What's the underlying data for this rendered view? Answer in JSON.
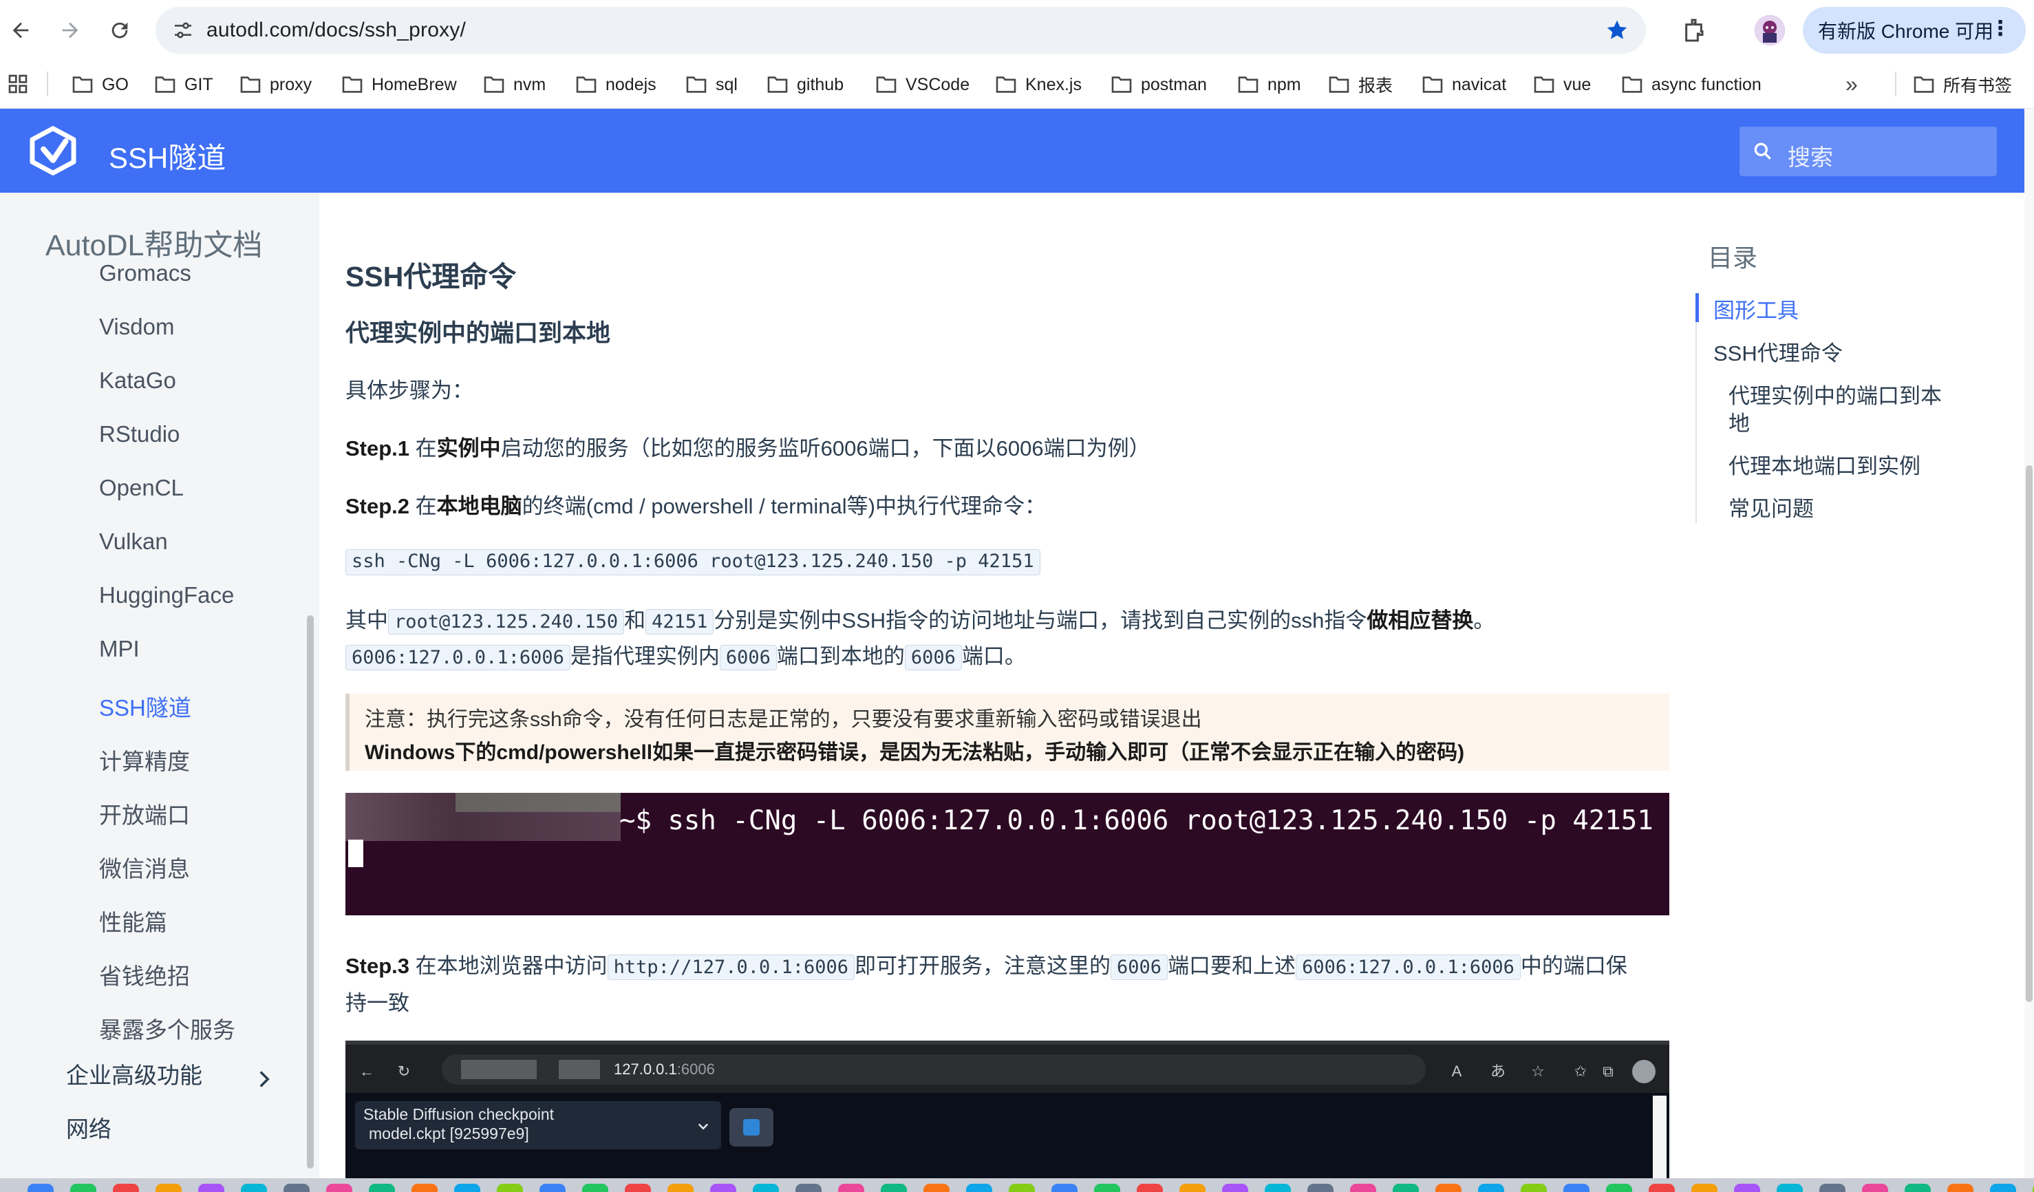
{
  "browser": {
    "url": "autodl.com/docs/ssh_proxy/",
    "update_button": "有新版 Chrome 可用",
    "bookmarks": [
      "GO",
      "GIT",
      "proxy",
      "HomeBrew",
      "nvm",
      "nodejs",
      "sql",
      "github",
      "VSCode",
      "Knex.js",
      "postman",
      "npm",
      "报表",
      "navicat",
      "vue",
      "async function"
    ],
    "all_bookmarks": "所有书签",
    "overflow": "»"
  },
  "header": {
    "site_title": "SSH隧道",
    "search_placeholder": "搜索"
  },
  "sidebar": {
    "title": "AutoDL帮助文档",
    "items": [
      "Gromacs",
      "Visdom",
      "KataGo",
      "RStudio",
      "OpenCL",
      "Vulkan",
      "HuggingFace",
      "MPI",
      "SSH隧道",
      "计算精度",
      "开放端口",
      "微信消息",
      "性能篇",
      "省钱绝招",
      "暴露多个服务"
    ],
    "active_item": "SSH隧道",
    "groups": [
      "企业高级功能",
      "网络"
    ]
  },
  "content": {
    "h2": "SSH代理命令",
    "h3": "代理实例中的端口到本地",
    "steps_intro": "具体步骤为：",
    "step1": {
      "label": "Step.1",
      "pre": "在",
      "bold": "实例中",
      "post": "启动您的服务（比如您的服务监听6006端口，下面以6006端口为例）"
    },
    "step2": {
      "label": "Step.2",
      "pre": "在",
      "bold": "本地电脑",
      "post": "的终端(cmd / powershell / terminal等)中执行代理命令："
    },
    "code_command": "ssh -CNg -L 6006:127.0.0.1:6006 root@123.125.240.150 -p 42151",
    "explain1": {
      "t1": "其中",
      "c1": "root@123.125.240.150",
      "t2": "和",
      "c2": "42151",
      "t3": "分别是实例中SSH指令的访问地址与端口，请找到自己实例的ssh指令",
      "bold": "做相应替换",
      "t4": "。"
    },
    "explain2": {
      "c1": "6006:127.0.0.1:6006",
      "t1": "是指代理实例内",
      "c2": "6006",
      "t2": "端口到本地的",
      "c3": "6006",
      "t3": "端口。"
    },
    "note_line1": "注意：执行完这条ssh命令，没有任何日志是正常的，只要没有要求重新输入密码或错误退出",
    "note_line2": "Windows下的cmd/powershell如果一直提示密码错误，是因为无法粘贴，手动输入即可（正常不会显示正在输入的密码)",
    "terminal_prompt": "~$ ",
    "terminal_command": "ssh -CNg -L 6006:127.0.0.1:6006 root@123.125.240.150 -p 42151",
    "step3": {
      "label": "Step.3",
      "t1": "在本地浏览器中访问",
      "c1": "http://127.0.0.1:6006",
      "t2": "即可打开服务，注意这里的",
      "c2": "6006",
      "t3": "端口要和上述",
      "c3": "6006:127.0.0.1:6006",
      "t4": "中的端口保",
      "t5": "持一致"
    },
    "screenshot": {
      "url_host": "127.0.0.1",
      "url_port": ":6006",
      "sd_label": "Stable Diffusion checkpoint",
      "sd_value": "model.ckpt [925997e9]"
    }
  },
  "toc": {
    "title": "目录",
    "items": [
      "图形工具",
      "SSH代理命令",
      "代理实例中的端口到本",
      "地",
      "代理本地端口到实例",
      "常见问题"
    ],
    "active": "图形工具"
  },
  "colors": {
    "brand": "#3e6ff5",
    "terminal_bg": "#2d0a24",
    "note_bg": "#fdf5ec"
  }
}
